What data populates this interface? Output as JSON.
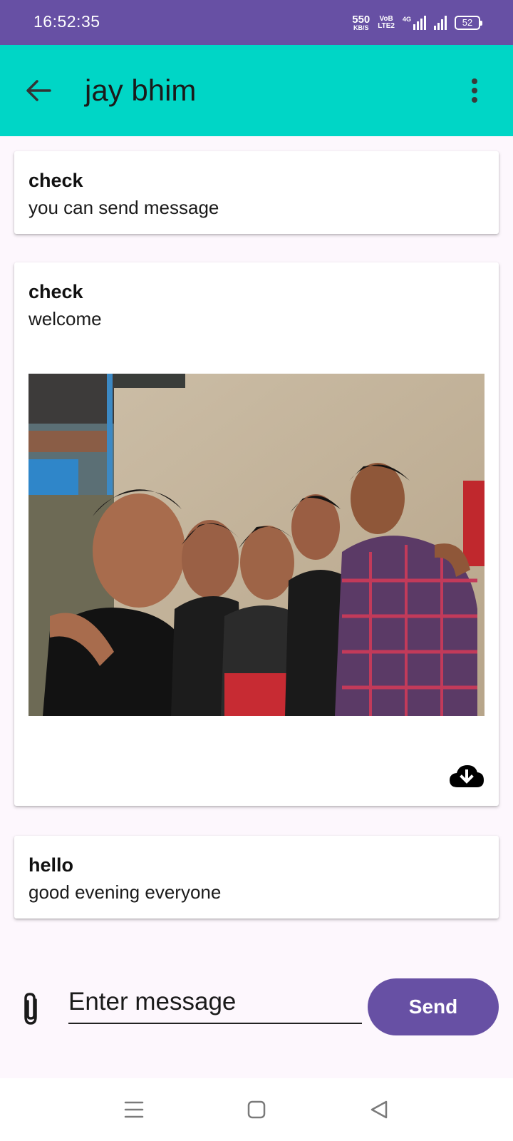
{
  "status_bar": {
    "time": "16:52:35",
    "net_speed_value": "550",
    "net_speed_unit": "KB/S",
    "volte_top": "VoB",
    "volte_bottom": "LTE2",
    "signal_label": "4G",
    "battery": "52"
  },
  "app_bar": {
    "title": "jay bhim",
    "back_icon": "arrow-left-icon",
    "menu_icon": "more-vertical-icon"
  },
  "messages": [
    {
      "sender": "check",
      "text": "you can send message"
    },
    {
      "sender": "check",
      "text": "welcome",
      "has_image": true,
      "download_icon": "cloud-download-icon"
    },
    {
      "sender": "hello",
      "text": "good evening everyone"
    }
  ],
  "composer": {
    "attach_icon": "paperclip-icon",
    "placeholder": "Enter message",
    "value": "",
    "send_label": "Send"
  },
  "nav_bar": {
    "icons": [
      "menu-icon",
      "home-square-icon",
      "back-triangle-icon"
    ]
  },
  "colors": {
    "status_bar": "#6750a4",
    "app_bar": "#00d6c6",
    "accent": "#6750a4",
    "background": "#fdf7fd"
  }
}
